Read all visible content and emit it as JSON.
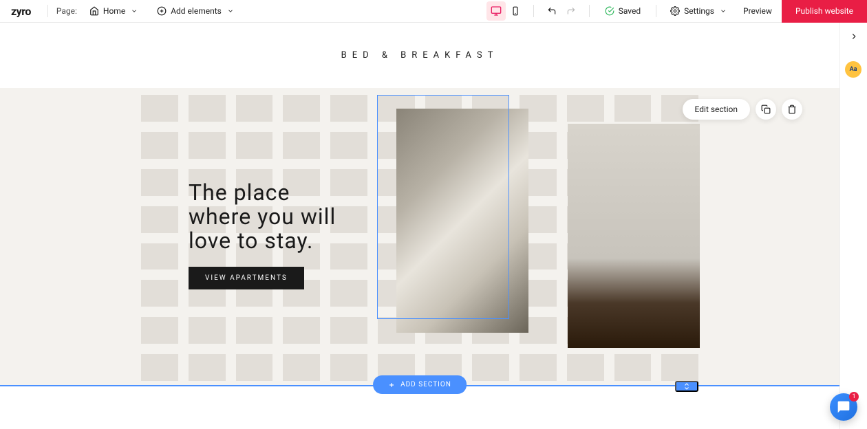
{
  "brand": "zyro",
  "toolbar": {
    "page_label": "Page:",
    "page_name": "Home",
    "add_elements": "Add elements",
    "saved": "Saved",
    "settings": "Settings",
    "preview": "Preview",
    "publish": "Publish website"
  },
  "site": {
    "title": "BED & BREAKFAST"
  },
  "hero": {
    "heading_line1": "The place",
    "heading_line2": "where you will",
    "heading_line3": "love to stay.",
    "cta": "VIEW APARTMENTS"
  },
  "section_controls": {
    "edit": "Edit section",
    "add": "ADD SECTION"
  },
  "rail": {
    "aa": "Aa"
  },
  "chat": {
    "badge": "1"
  },
  "colors": {
    "accent": "#e91e45",
    "selection": "#4a90ff",
    "canvas_bg": "#f4f2ee"
  }
}
